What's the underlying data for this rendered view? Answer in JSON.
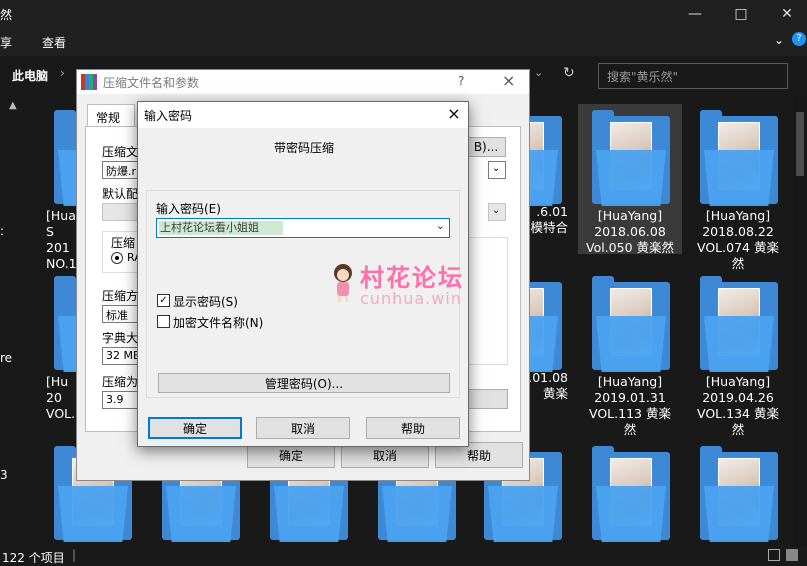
{
  "explorer": {
    "window_title_fragment": "然",
    "ribbon_tab_share": "享",
    "ribbon_tab_view": "查看",
    "breadcrumb_this_pc": "此电脑",
    "search_placeholder": "搜索\"黄乐然\"",
    "status_item_count": "122 个项目",
    "nav_chars": [
      ":",
      "re",
      "3"
    ],
    "folders": [
      {
        "caption": "[HuaYang]\n2018.06.08\nVol.050 黄楽然"
      },
      {
        "caption": "[HuaYang]\n2018.08.22\nVOL.074 黄楽\n然"
      },
      {
        "caption": "[HuaYang]\n2019.01.31\nVOL.113 黄楽\n然"
      },
      {
        "caption": "[HuaYang]\n2019.04.26\nVOL.134 黄楽\n然"
      }
    ],
    "partial_captions": {
      "col1_row1": "[HuaY\nS\n201\nNO.1",
      "col1_row2": "[Hu\n20\nVOL.",
      "col5_row1": ".6.01\n模特合",
      "col5_row2": ".01.08\n黄楽"
    }
  },
  "dialog_archive": {
    "title": "压缩文件名和参数",
    "help": "?",
    "close": "×",
    "tab_general": "常规",
    "label_archive_name": "压缩文",
    "archive_name_value": "防爆.r",
    "label_default_profile": "默认配",
    "label_format": "压缩",
    "radio_rar": "RA",
    "label_method": "压缩方",
    "method_value": "标准",
    "label_dict": "字典大",
    "dict_value": "32 MB",
    "label_split": "压缩为",
    "split_value": "3.9",
    "browse_button": "B)...",
    "ok": "确定",
    "cancel": "取消",
    "help_button": "帮助"
  },
  "dialog_password": {
    "title": "输入密码",
    "close": "×",
    "subtitle": "带密码压缩",
    "label_enter_password": "输入密码(E)",
    "password_value": "上村花论坛看小姐姐",
    "show_password": "显示密码(S)",
    "show_password_checked": true,
    "encrypt_filenames": "加密文件名称(N)",
    "encrypt_filenames_checked": false,
    "organize_button": "管理密码(O)...",
    "ok": "确定",
    "cancel": "取消",
    "help": "帮助"
  },
  "watermark": {
    "title": "村花论坛",
    "sub": "cunhua.win"
  }
}
